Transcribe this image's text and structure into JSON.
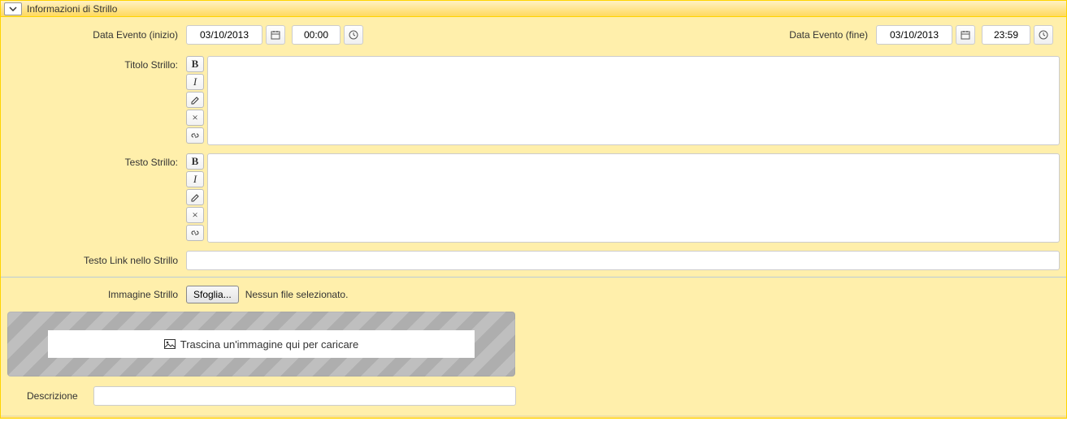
{
  "panel": {
    "title": "Informazioni di Strillo"
  },
  "date_start": {
    "label": "Data Evento (inizio)",
    "date": "03/10/2013",
    "time": "00:00"
  },
  "date_end": {
    "label": "Data Evento (fine)",
    "date": "03/10/2013",
    "time": "23:59"
  },
  "titolo": {
    "label": "Titolo Strillo:",
    "value": ""
  },
  "testo": {
    "label": "Testo Strillo:",
    "value": ""
  },
  "link_text": {
    "label": "Testo Link nello Strillo",
    "value": ""
  },
  "image": {
    "label": "Immagine Strillo",
    "browse": "Sfoglia...",
    "status": "Nessun file selezionato.",
    "drop_text": "Trascina un'immagine qui per caricare"
  },
  "description": {
    "label": "Descrizione",
    "value": ""
  },
  "editor_tools": {
    "bold": "B",
    "italic": "I",
    "clear": "×"
  }
}
